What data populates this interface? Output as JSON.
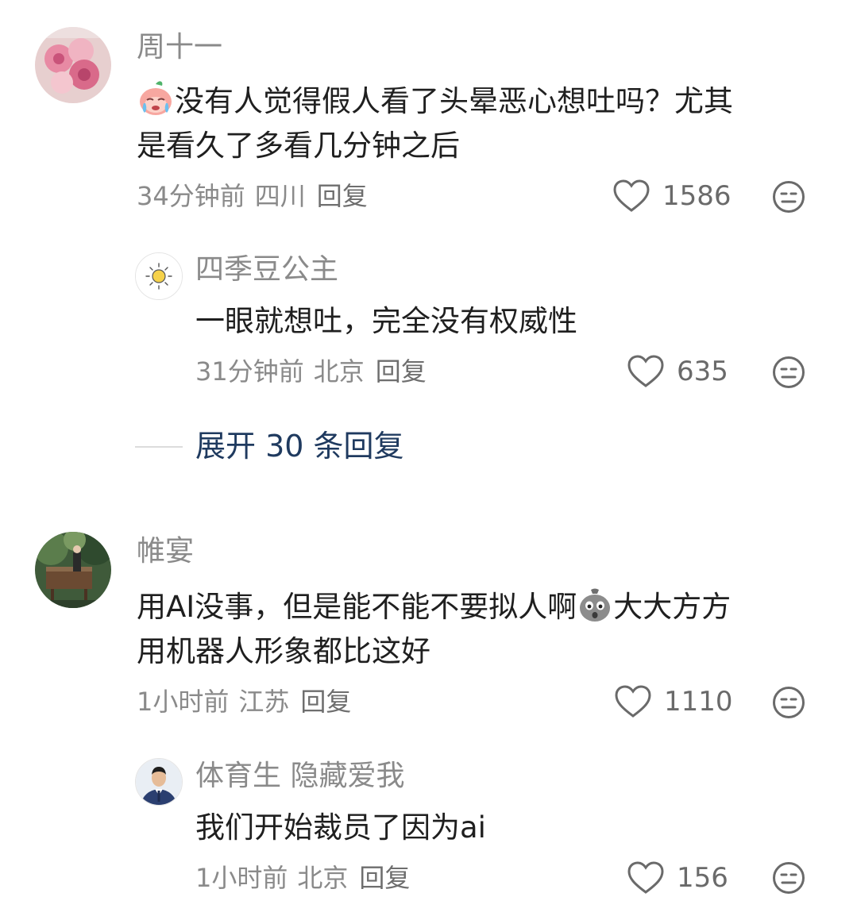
{
  "comments": [
    {
      "username": "周十一",
      "text_line1": "没有人觉得假人看了头晕恶心想吐吗？尤其",
      "text_line2": "是看久了多看几分钟之后",
      "emoji": "crying-peach-emoji",
      "time": "34分钟前",
      "location": "四川",
      "reply_label": "回复",
      "likes": "1586",
      "avatar": "pink-roses-avatar",
      "reply": {
        "username": "四季豆公主",
        "text": "一眼就想吐，完全没有权威性",
        "time": "31分钟前",
        "location": "北京",
        "reply_label": "回复",
        "likes": "635",
        "avatar": "sun-sketch-avatar"
      },
      "expand_label": "展开 30 条回复"
    },
    {
      "username": "帷宴",
      "text_part1": "用AI没事，但是能不能不要拟人啊",
      "text_part2": "大大方方",
      "text_line2": "用机器人形象都比这好",
      "emoji": "shocked-sack-emoji",
      "time": "1小时前",
      "location": "江苏",
      "reply_label": "回复",
      "likes": "1110",
      "avatar": "forest-piano-avatar",
      "reply": {
        "username": "体育生 隐藏爱我",
        "text": "我们开始裁员了因为ai",
        "time": "1小时前",
        "location": "北京",
        "reply_label": "回复",
        "likes": "156",
        "avatar": "man-in-suit-avatar"
      }
    }
  ],
  "colors": {
    "username": "#8a8a8a",
    "body": "#1f1f1f",
    "expand": "#1f3a5f",
    "icon": "#6a6a6a"
  }
}
